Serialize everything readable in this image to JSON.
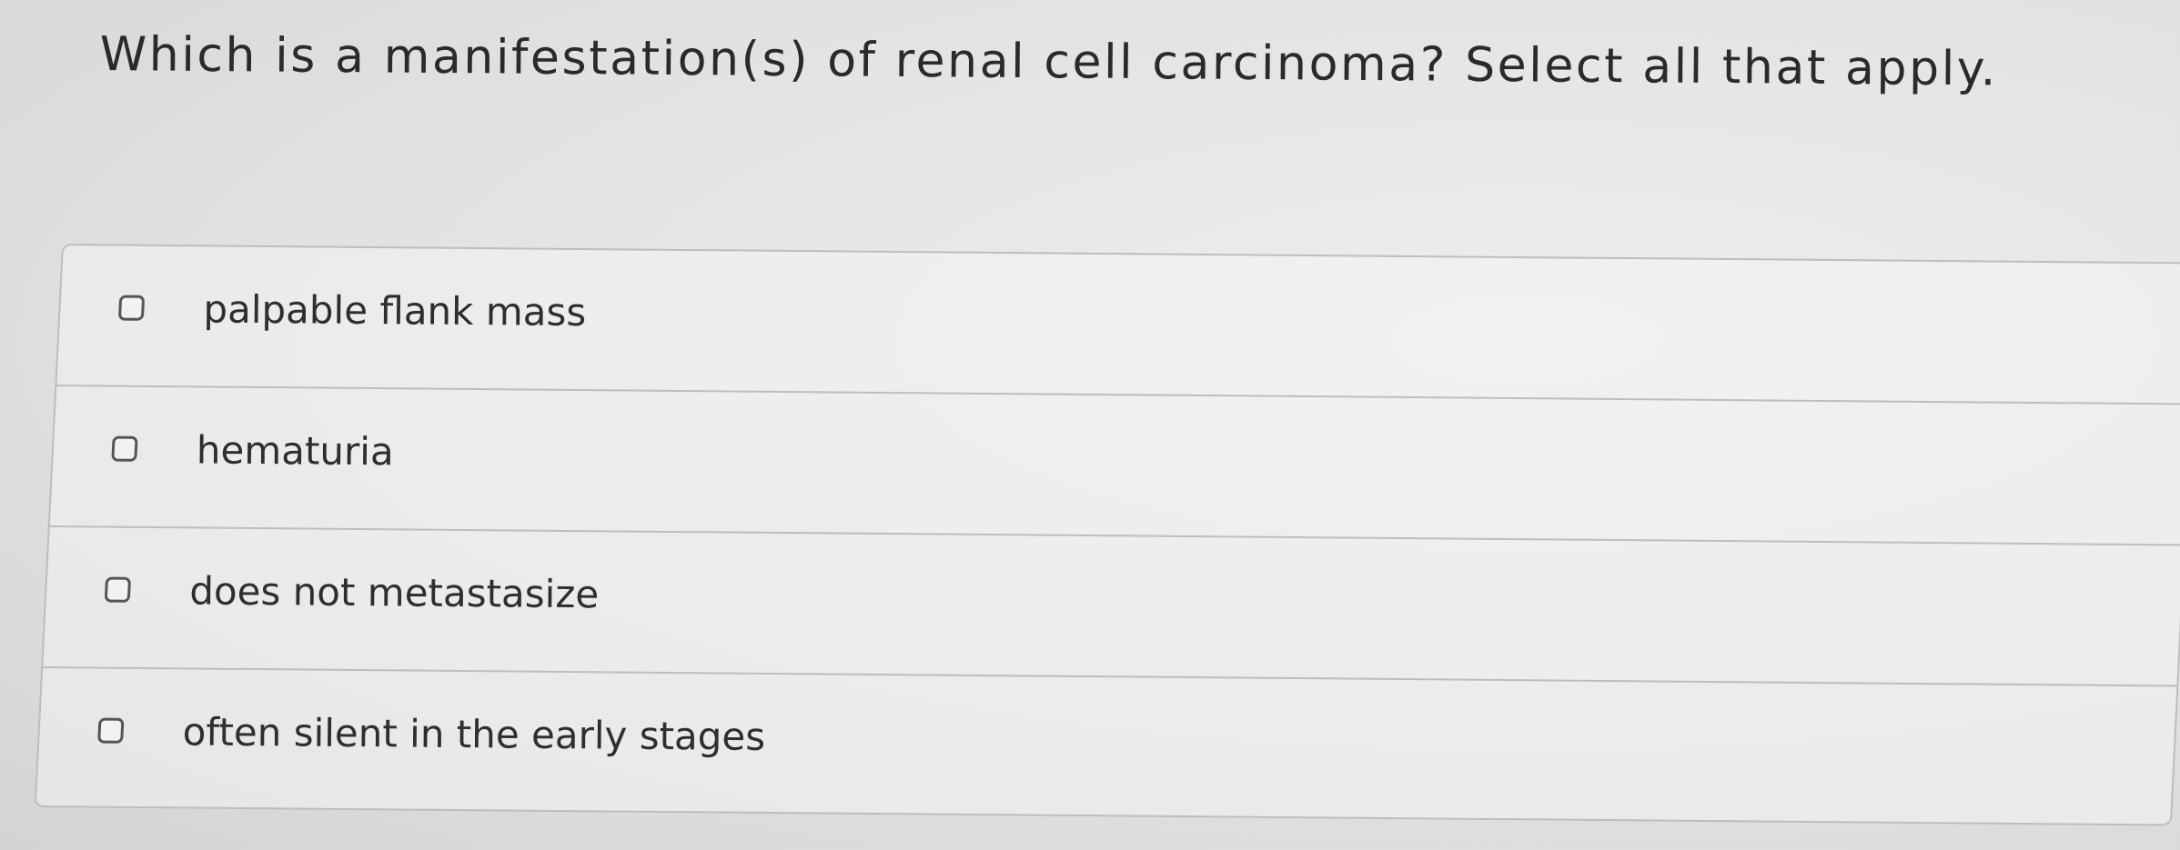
{
  "question": {
    "text": "Which is a manifestation(s) of renal cell carcinoma? Select all that apply."
  },
  "options": [
    {
      "label": "palpable flank mass",
      "checked": false
    },
    {
      "label": "hematuria",
      "checked": false
    },
    {
      "label": "does not metastasize",
      "checked": false
    },
    {
      "label": "often silent in the early stages",
      "checked": false
    }
  ]
}
